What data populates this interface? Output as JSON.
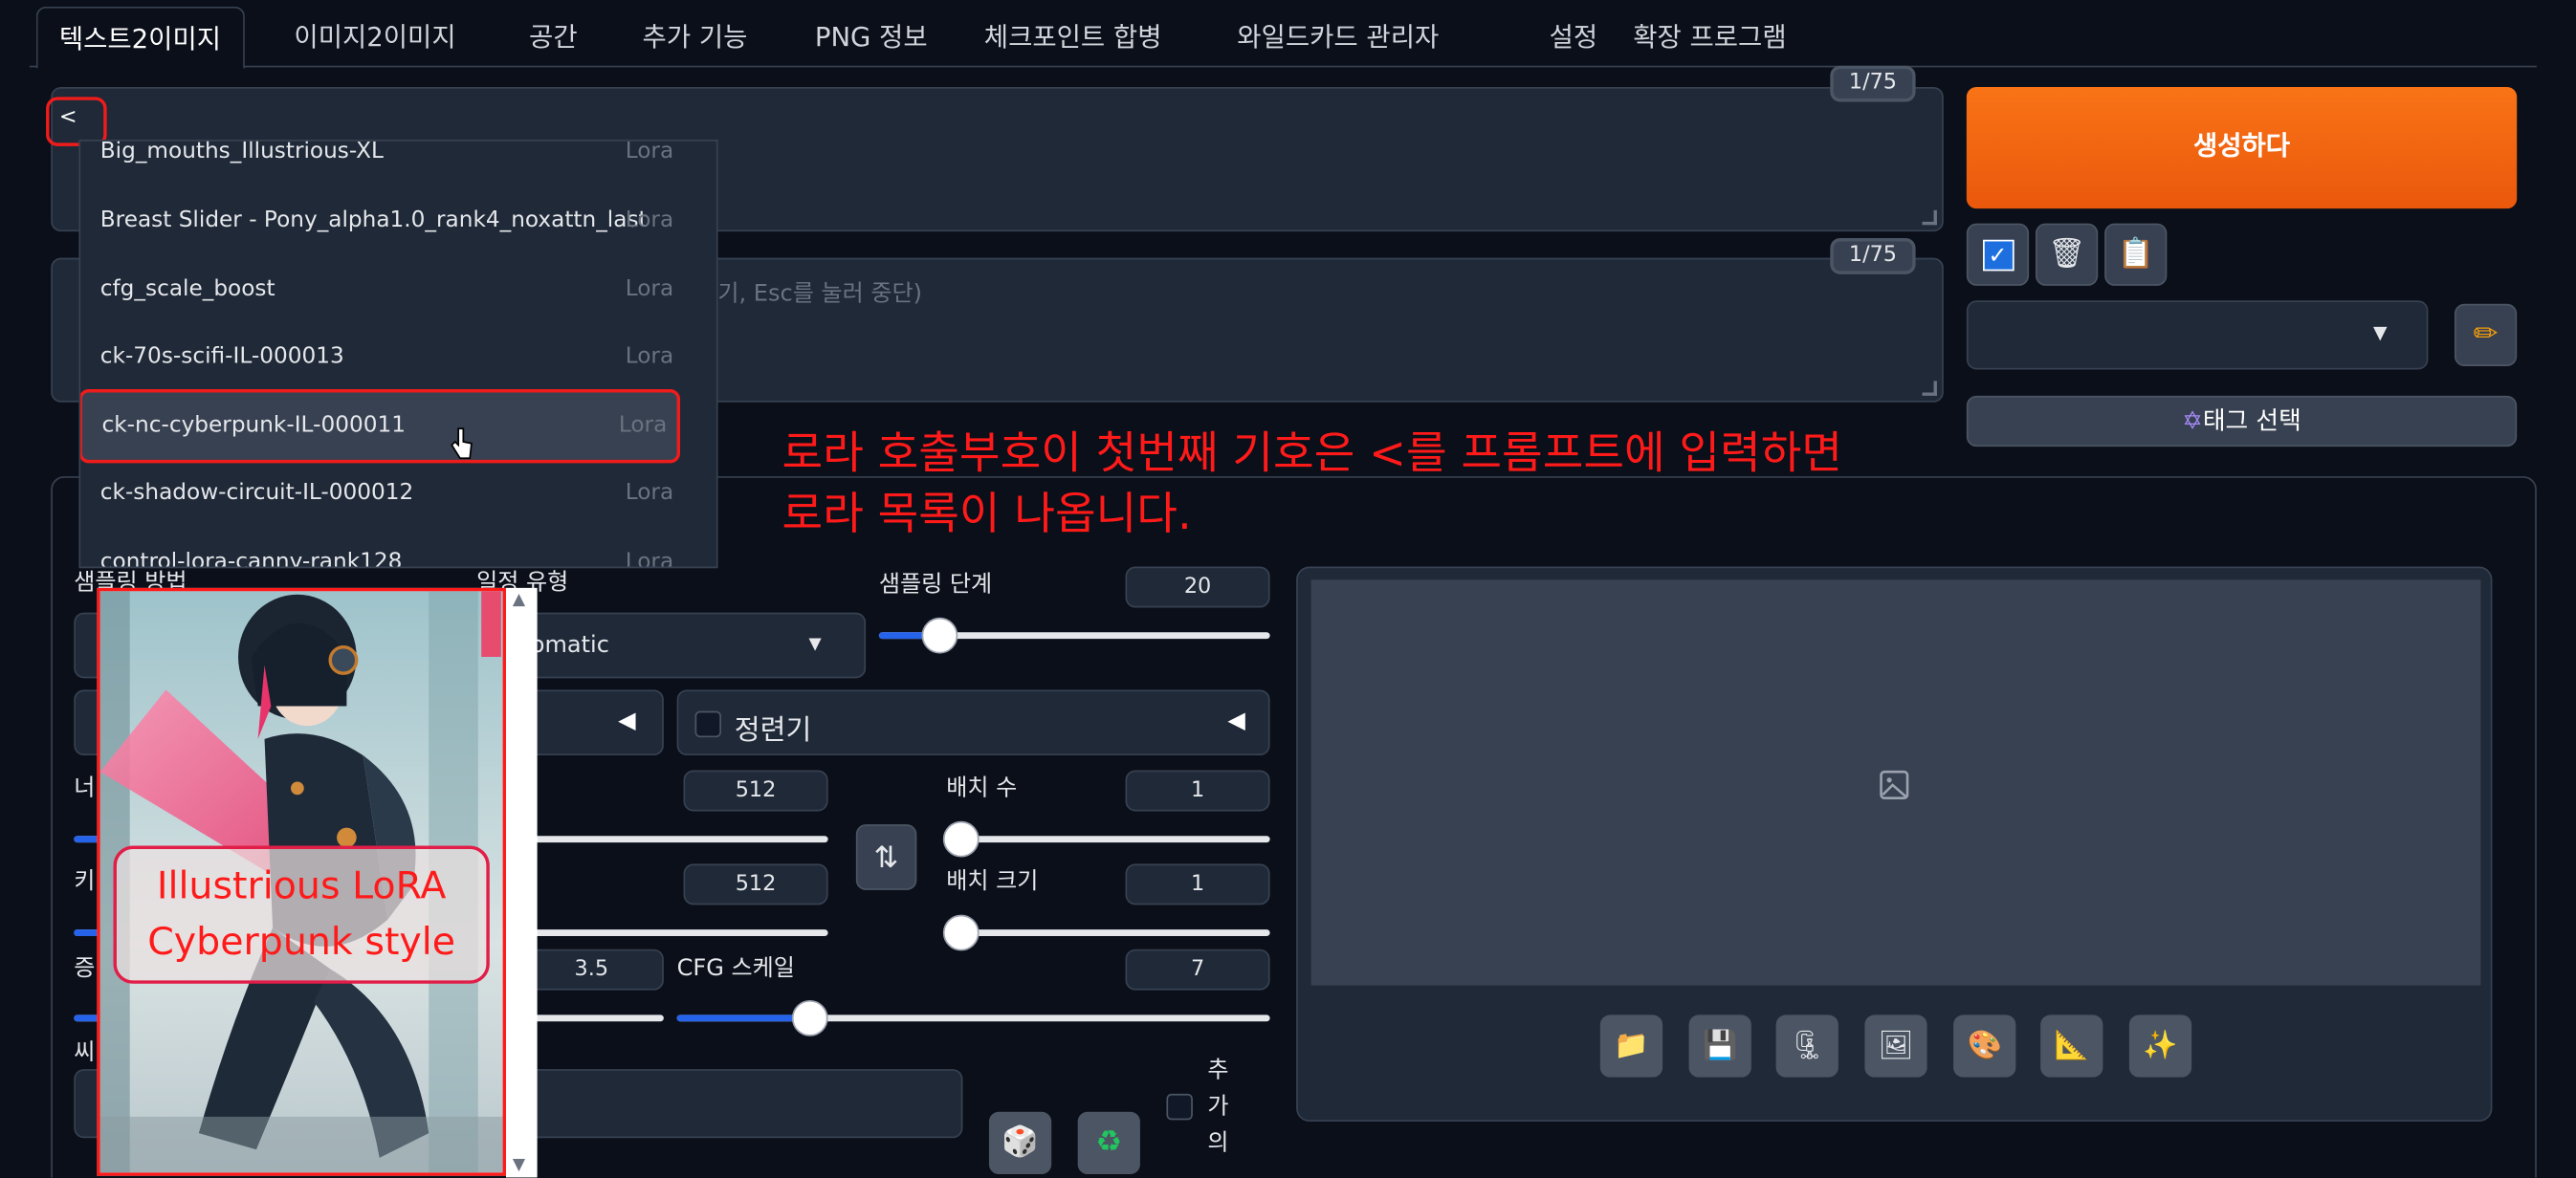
{
  "tabs": [
    "텍스트2이미지",
    "이미지2이미지",
    "공간",
    "추가 기능",
    "PNG 정보",
    "체크포인트 합병",
    "와일드카드 관리자",
    "설정",
    "확장 프로그램"
  ],
  "prompt": {
    "back_label": "<",
    "counter": "1/75"
  },
  "negative": {
    "counter": "1/75",
    "placeholder_fragment": "뛰기, Esc를 눌러 중단)"
  },
  "generate_label": "생성하다",
  "tag_select_label": "태그 선택",
  "lora_list": {
    "items": [
      {
        "name": "Big_mouths_Illustrious-XL",
        "type": "Lora"
      },
      {
        "name": "Breast Slider - Pony_alpha1.0_rank4_noxattn_last",
        "type": "Lora"
      },
      {
        "name": "cfg_scale_boost",
        "type": "Lora"
      },
      {
        "name": "ck-70s-scifi-IL-000013",
        "type": "Lora"
      },
      {
        "name": "ck-nc-cyberpunk-IL-000011",
        "type": "Lora"
      },
      {
        "name": "ck-shadow-circuit-IL-000012",
        "type": "Lora"
      },
      {
        "name": "control-lora-canny-rank128",
        "type": "Lora"
      }
    ]
  },
  "callout": {
    "line1": "로라 호출부호이 첫번째 기호은 <를 프롬프트에 입력하면",
    "line2": "로라 목록이 나옵니다."
  },
  "preview": {
    "label_line1": "Illustrious LoRA",
    "label_line2": "Cyberpunk style"
  },
  "settings": {
    "sampling_method_label": "샘플링 방법",
    "schedule_type_label": "일정 유형",
    "schedule_value": "omatic",
    "sampling_steps_label": "샘플링 단계",
    "sampling_steps_value": "20",
    "sampling_steps_fraction": 0.25,
    "refiner_label": "정련기",
    "width_label": "너",
    "width_value": "512",
    "height_label": "키",
    "height_value": "512",
    "batch_count_label": "배치 수",
    "batch_count_value": "1",
    "batch_size_label": "배치 크기",
    "batch_size_value": "1",
    "distilled_label": "증",
    "distilled_value": "3.5",
    "cfg_label": "CFG 스케일",
    "cfg_value": "7",
    "cfg_fraction": 0.2,
    "seed_label": "씨",
    "extra_label": [
      "추",
      "가",
      "의"
    ]
  },
  "icons": {
    "folder": "📁",
    "save": "💾",
    "zip": "🗜",
    "image": "🖼",
    "palette": "🎨",
    "ruler": "📐",
    "sparkle": "✨",
    "dice": "🎲",
    "recycle": "♻",
    "trash": "🗑",
    "clipboard": "📋",
    "pencil": "✏",
    "star": "✡",
    "check": "✓",
    "swap": "⇅"
  }
}
